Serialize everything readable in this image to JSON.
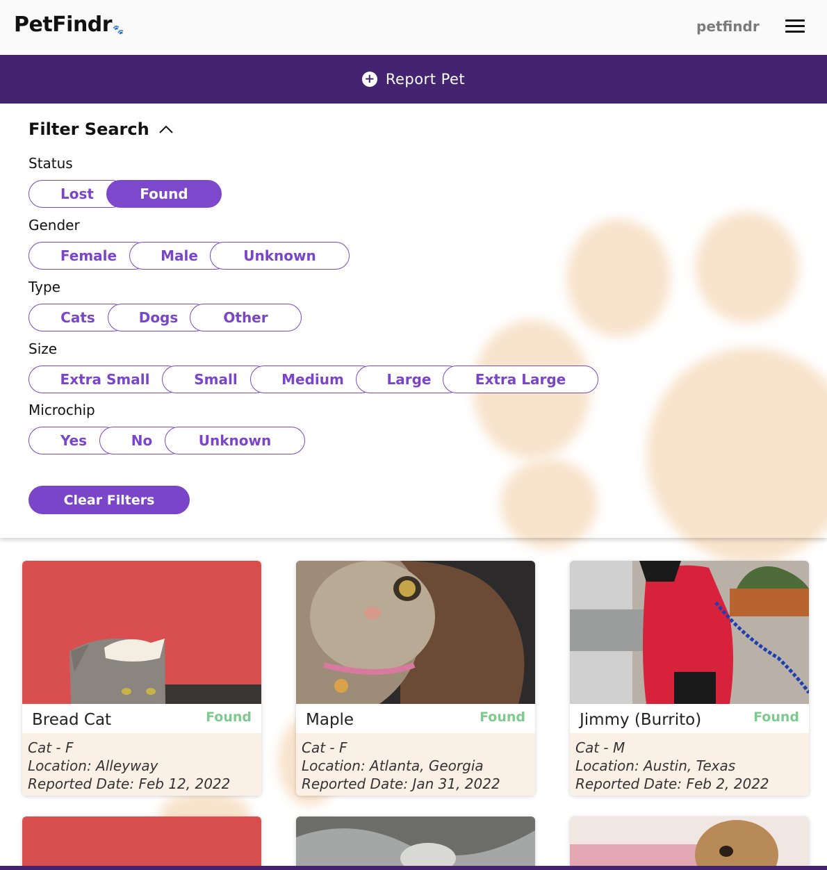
{
  "header": {
    "logo": "PetFindr",
    "username": "petfindr",
    "menu_icon": "hamburger-menu-icon"
  },
  "report_bar": {
    "label": "Report Pet",
    "icon": "plus-circle-icon"
  },
  "filters": {
    "title": "Filter Search",
    "collapse_icon": "chevron-up-icon",
    "status": {
      "label": "Status",
      "options": [
        "Lost",
        "Found"
      ],
      "selected": "Found"
    },
    "gender": {
      "label": "Gender",
      "options": [
        "Female",
        "Male",
        "Unknown"
      ]
    },
    "type": {
      "label": "Type",
      "options": [
        "Cats",
        "Dogs",
        "Other"
      ]
    },
    "size": {
      "label": "Size",
      "options": [
        "Extra Small",
        "Small",
        "Medium",
        "Large",
        "Extra Large"
      ]
    },
    "microchip": {
      "label": "Microchip",
      "options": [
        "Yes",
        "No",
        "Unknown"
      ]
    },
    "clear_label": "Clear Filters"
  },
  "colors": {
    "brand_dark": "#442470",
    "brand": "#7a45c9",
    "found_green": "#7dca8e",
    "details_bg": "#fbf0e6"
  },
  "pets": [
    {
      "name": "Bread Cat",
      "status": "Found",
      "type_gender": "Cat - F",
      "location": "Location: Alleyway",
      "reported": "Reported Date: Feb 12, 2022"
    },
    {
      "name": "Maple",
      "status": "Found",
      "type_gender": "Cat - F",
      "location": "Location: Atlanta, Georgia",
      "reported": "Reported Date: Jan 31, 2022"
    },
    {
      "name": "Jimmy (Burrito)",
      "status": "Found",
      "type_gender": "Cat - M",
      "location": "Location: Austin, Texas",
      "reported": "Reported Date: Feb 2, 2022"
    }
  ]
}
